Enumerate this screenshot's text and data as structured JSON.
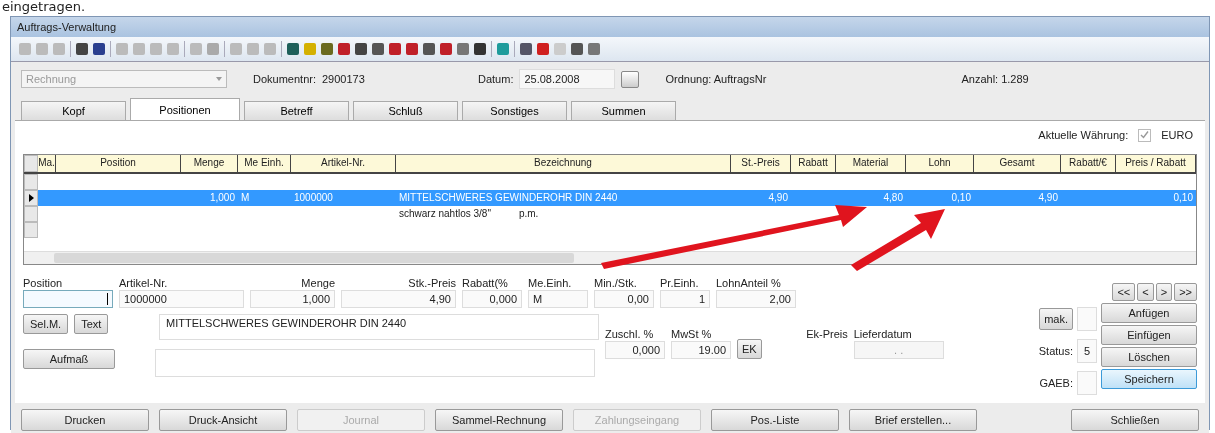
{
  "doc_text": "eingetragen.",
  "window": {
    "title": "Auftrags-Verwaltung"
  },
  "header": {
    "doc_type": {
      "value": "Rechnung",
      "disabled": true
    },
    "docnr_label": "Dokumentnr:",
    "docnr": "2900173",
    "date_label": "Datum:",
    "date": "25.08.2008",
    "order": "Ordnung: AuftragsNr",
    "count": "Anzahl: 1.289"
  },
  "tabs": [
    {
      "label": "Kopf",
      "selected": false
    },
    {
      "label": "Positionen",
      "selected": true
    },
    {
      "label": "Betreff",
      "selected": false
    },
    {
      "label": "Schluß",
      "selected": false
    },
    {
      "label": "Sonstiges",
      "selected": false
    },
    {
      "label": "Summen",
      "selected": false
    }
  ],
  "currency": {
    "label": "Aktuelle Währung:",
    "checked": true,
    "value": "EURO"
  },
  "table": {
    "columns": [
      "Ma.",
      "Position",
      "Menge",
      "Me Einh.",
      "Artikel-Nr.",
      "Bezeichnung",
      "St.-Preis",
      "Rabatt",
      "Material",
      "Lohn",
      "Gesamt",
      "Rabatt/€",
      "Preis / Rabatt"
    ],
    "rows": [
      {
        "selected": false,
        "cells": [
          "",
          "",
          "",
          "",
          "",
          "",
          "",
          "",
          "",
          "",
          "",
          "",
          ""
        ]
      },
      {
        "selected": true,
        "cells": [
          "",
          "",
          "1,000",
          "M",
          "1000000",
          "MITTELSCHWERES GEWINDEROHR DIN 2440",
          "4,90",
          "",
          "4,80",
          "0,10",
          "4,90",
          "",
          "0,10"
        ]
      },
      {
        "selected": false,
        "cells": [
          "",
          "",
          "",
          "",
          "",
          [
            "schwarz nahtlos 3/8\"",
            "p.m."
          ],
          "",
          "",
          "",
          "",
          "",
          "",
          ""
        ]
      },
      {
        "selected": false,
        "cells": [
          "",
          "",
          "",
          "",
          "",
          "",
          "",
          "",
          "",
          "",
          "",
          "",
          ""
        ]
      }
    ]
  },
  "form": {
    "fields": [
      {
        "label": "Position",
        "focused": true
      },
      {
        "label": "Artikel-Nr.",
        "value": "1000000",
        "focused": false
      },
      {
        "label": "Menge",
        "value": "1,000",
        "focused": false
      },
      {
        "label": "Stk.-Preis",
        "value": "4,90",
        "focused": false
      },
      {
        "label": "Rabatt(%",
        "value": "0,000",
        "focused": false
      },
      {
        "label": "Me.Einh.",
        "value": "M",
        "focused": false
      },
      {
        "label": "Min./Stk.",
        "value": "0,00",
        "focused": false
      },
      {
        "label": "Pr.Einh.",
        "value": "1",
        "focused": false
      },
      {
        "label": "LohnAnteil %",
        "value": "2,00",
        "focused": false
      }
    ],
    "side_buttons": [
      "Sel.M.",
      "Text",
      "Aufmaß"
    ],
    "description": "MITTELSCHWERES GEWINDEROHR DIN 2440",
    "extra": [
      {
        "label": "Zuschl. %",
        "value": "0,000"
      },
      {
        "label": "MwSt %",
        "value": "19.00"
      }
    ],
    "ek_button": "EK",
    "ek_price_label": "Ek-Preis",
    "delivery_label": "Lieferdatum",
    "delivery_value": ". .",
    "nav_buttons": [
      "<<",
      "<",
      ">",
      ">>"
    ],
    "mak_button": "mak.",
    "status_label": "Status:",
    "status_value": "5",
    "gaeb_label": "GAEB:",
    "actions": [
      {
        "label": "Anfügen",
        "focused": false
      },
      {
        "label": "Einfügen",
        "focused": false
      },
      {
        "label": "Löschen",
        "focused": false
      },
      {
        "label": "Speichern",
        "focused": true
      }
    ]
  },
  "bottom_buttons": [
    {
      "label": "Drucken",
      "disabled": false
    },
    {
      "label": "Druck-Ansicht",
      "disabled": false
    },
    {
      "label": "Journal",
      "disabled": true
    },
    {
      "label": "Sammel-Rechnung",
      "disabled": false
    },
    {
      "label": "Zahlungseingang",
      "disabled": true
    },
    {
      "label": "Pos.-Liste",
      "disabled": false
    },
    {
      "label": "Brief erstellen...",
      "disabled": false
    },
    {
      "label": "Schließen",
      "disabled": false
    }
  ]
}
